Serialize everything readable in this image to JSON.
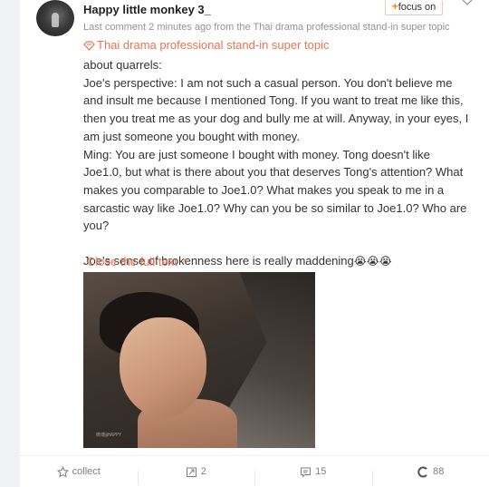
{
  "post": {
    "username": "Happy little monkey 3_",
    "focus_label": "focus on",
    "meta": "Last comment 2 minutes ago from the Thai drama professional stand-in super topic",
    "topic": "Thai drama professional stand-in super topic",
    "paragraphs": [
      "about quarrels:",
      "Joe's perspective: I am not such a casual person. You don't believe me and insult me because I mentioned Tong. If you want to treat me like this, then you treat me as your dog and bully me at will. Anyway, in your eyes, I am just someone you bought with money.",
      "Ming: You are just someone I bought with money. Tong doesn't like Joe1.0, but what is there about you that deserves Tong's attention? What makes you comparable to Joe1.0? What makes you speak to me in a sarcastic way like Joe1.0? Why can you be so similar to Joe1.0? Who are you?",
      "Joe's sense of brokenness here is really maddening"
    ],
    "emoji": "😭😭😭",
    "close_label": "Close the full text",
    "image_watermark": "微博@HAPPY"
  },
  "actions": {
    "collect": "collect",
    "repost_count": "2",
    "comment_count": "15",
    "like_count": "88"
  },
  "colors": {
    "accent": "#eb7350",
    "focus_plus": "#ff8200",
    "meta_gray": "#939393",
    "text": "#333333"
  }
}
